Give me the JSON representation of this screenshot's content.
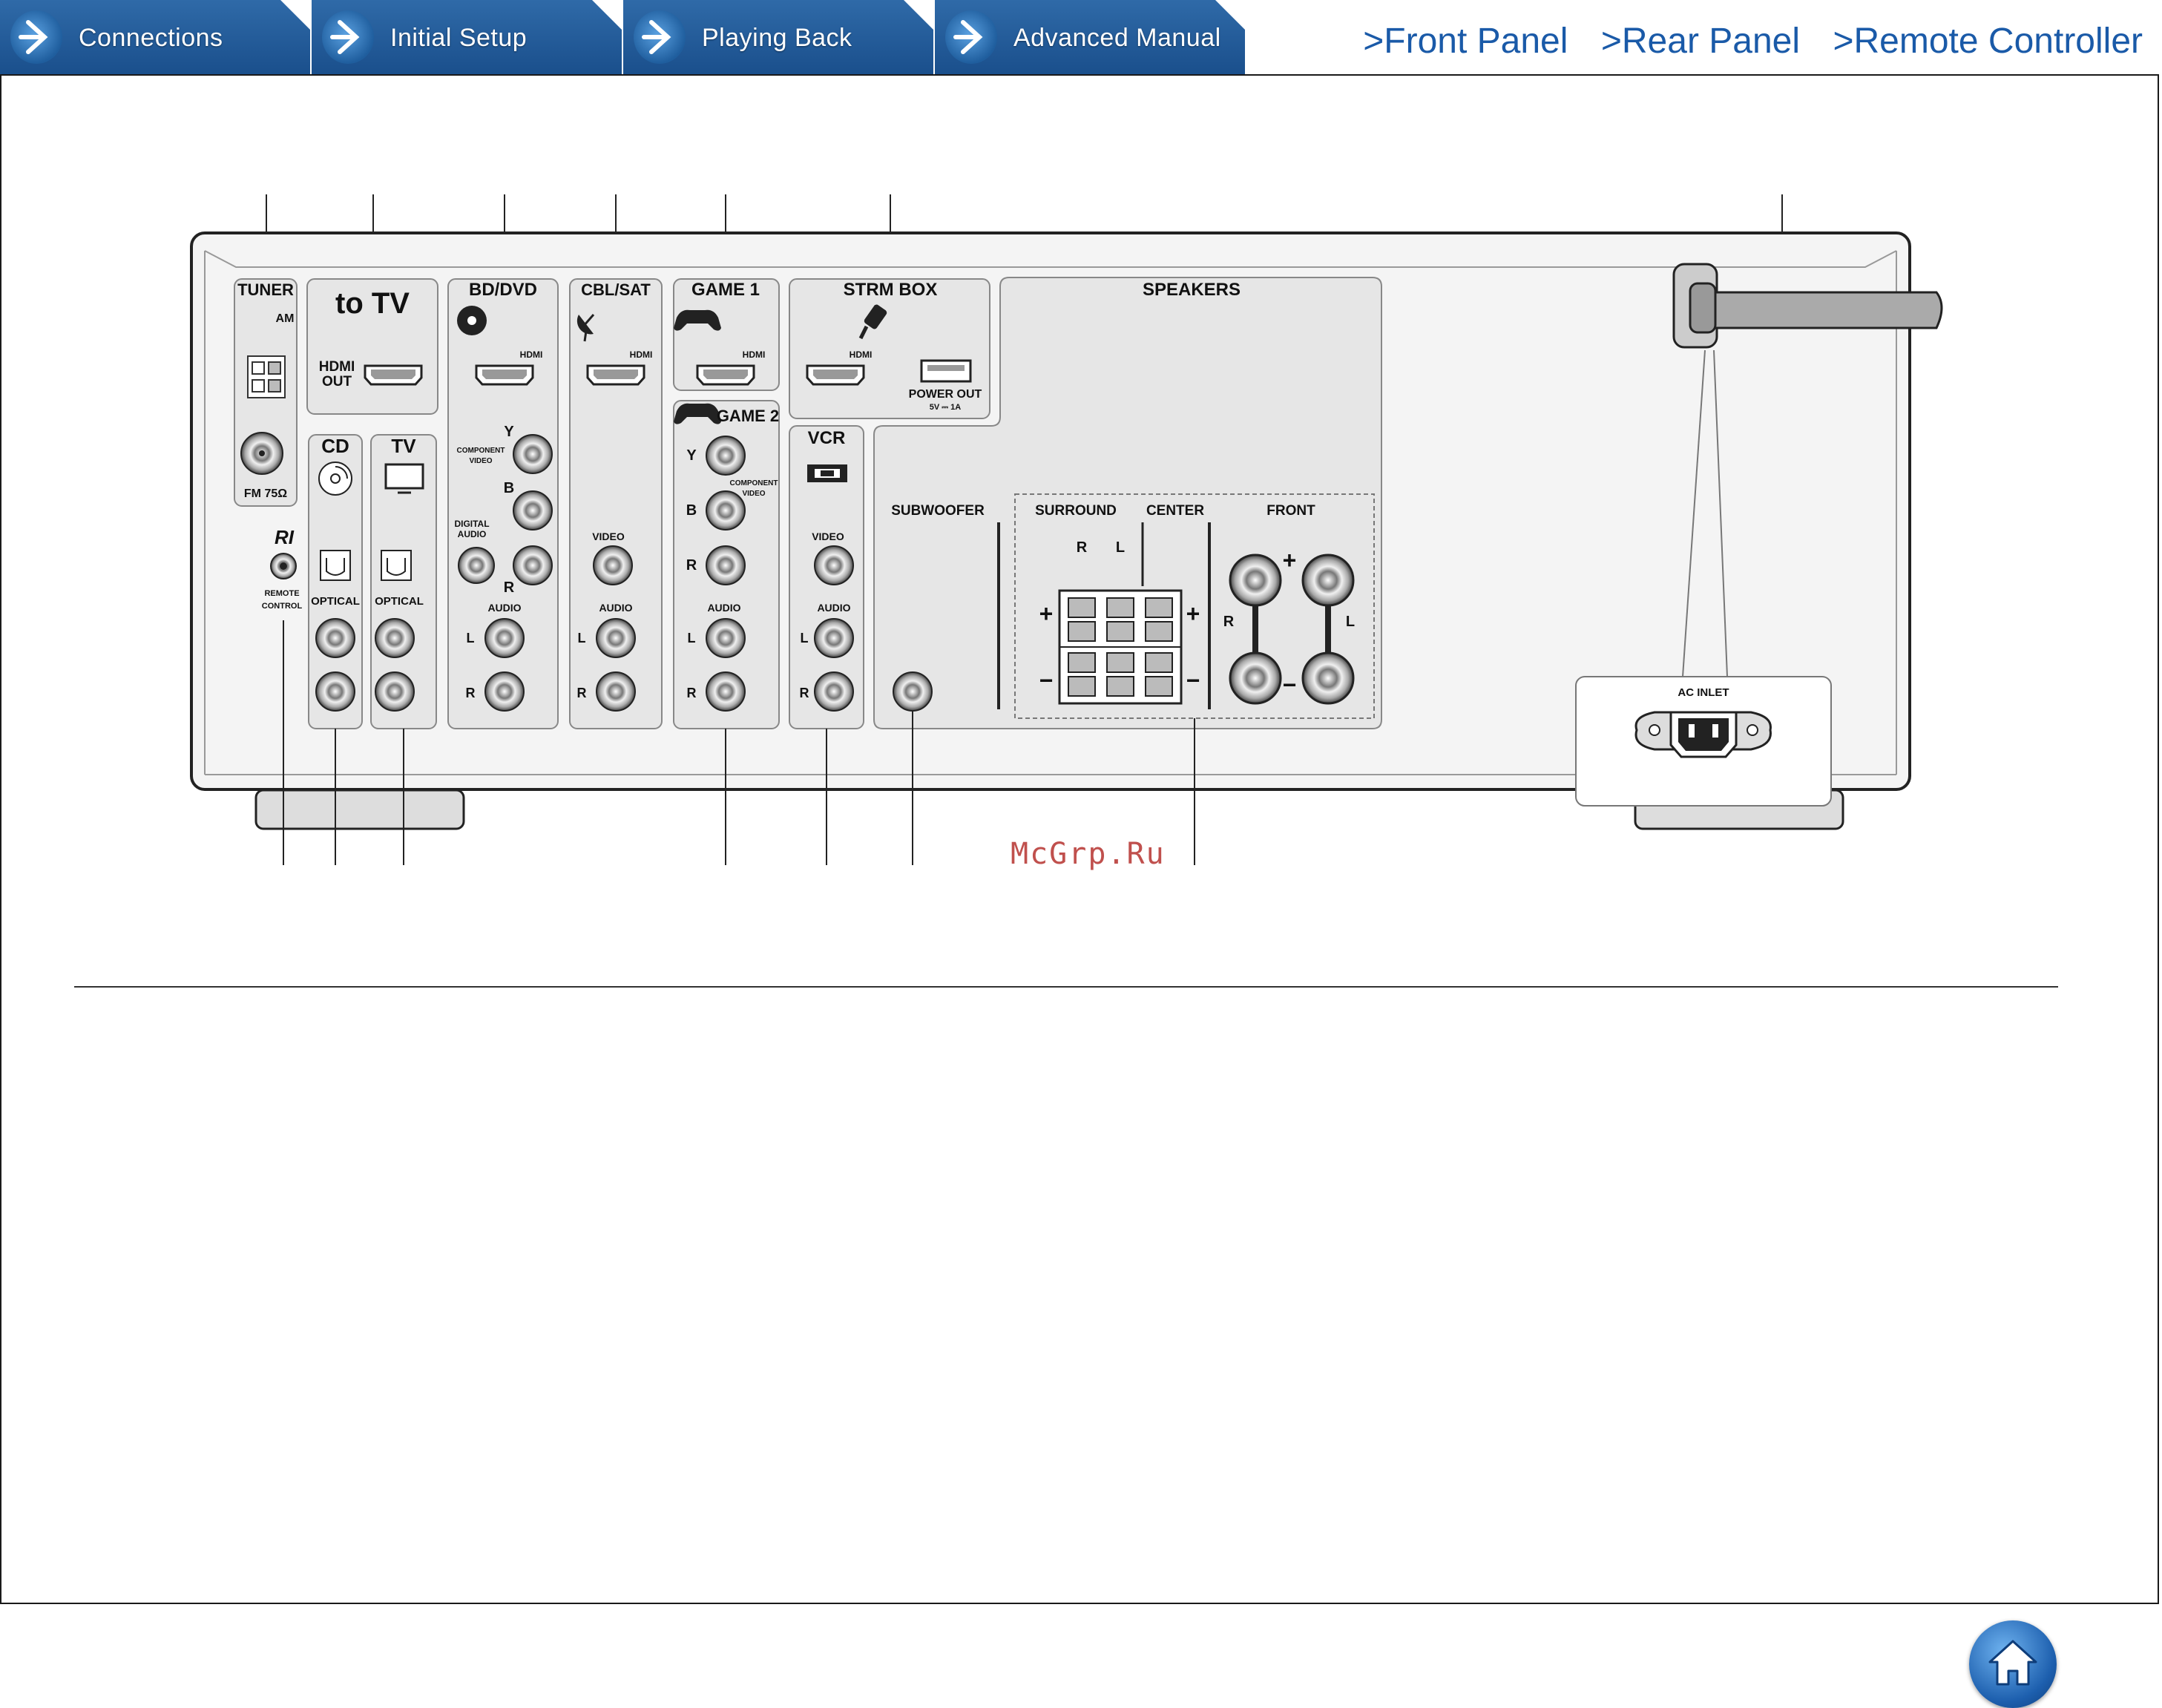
{
  "nav": {
    "tabs": [
      {
        "label": "Connections"
      },
      {
        "label": "Initial Setup"
      },
      {
        "label": "Playing Back"
      },
      {
        "label": "Advanced Manual"
      }
    ],
    "links": [
      {
        "label": ">Front Panel"
      },
      {
        "label": ">Rear Panel"
      },
      {
        "label": ">Remote Controller"
      }
    ]
  },
  "colors": {
    "tab_blue": "#1a4f8c",
    "link_blue": "#1a5aa8",
    "panel_gray": "#e6e6e6"
  },
  "watermark": "McGrp.Ru",
  "home_icon": "home-icon",
  "panel": {
    "tuner": {
      "title": "TUNER",
      "am": "AM",
      "fm": "FM 75Ω"
    },
    "to_tv": {
      "title": "to TV",
      "hdmi_out": "HDMI\nOUT",
      "hdmi_out_1": "HDMI",
      "hdmi_out_2": "OUT"
    },
    "ri": {
      "logo": "RI",
      "line1": "REMOTE",
      "line2": "CONTROL"
    },
    "cd": {
      "title": "CD",
      "optical": "OPTICAL"
    },
    "tv": {
      "title": "TV",
      "optical": "OPTICAL"
    },
    "bd_dvd": {
      "title": "BD/DVD",
      "hdmi": "HDMI",
      "y": "Y",
      "b": "B",
      "r": "R",
      "component_1": "COMPONENT",
      "component_2": "VIDEO",
      "digital_1": "DIGITAL",
      "digital_2": "AUDIO",
      "audio": "AUDIO",
      "l": "L",
      "r2": "R"
    },
    "cbl_sat": {
      "title": "CBL/SAT",
      "hdmi": "HDMI",
      "video": "VIDEO",
      "audio": "AUDIO",
      "l": "L",
      "r": "R"
    },
    "game1": {
      "title": "GAME 1",
      "hdmi": "HDMI"
    },
    "game2": {
      "title": "GAME 2",
      "y": "Y",
      "b": "B",
      "r": "R",
      "component_1": "COMPONENT",
      "component_2": "VIDEO",
      "audio": "AUDIO",
      "l": "L",
      "r2": "R"
    },
    "strm_box": {
      "title": "STRM BOX",
      "hdmi": "HDMI",
      "power_out": "POWER OUT",
      "power_spec": "5V ⎓ 1A"
    },
    "vcr": {
      "title": "VCR",
      "video": "VIDEO",
      "audio": "AUDIO",
      "l": "L",
      "r": "R"
    },
    "speakers": {
      "title": "SPEAKERS",
      "subwoofer": "SUBWOOFER",
      "surround": "SURROUND",
      "center": "CENTER",
      "front": "FRONT",
      "r": "R",
      "l": "L",
      "plus": "+",
      "minus": "−"
    },
    "ac_inlet": "AC INLET"
  }
}
